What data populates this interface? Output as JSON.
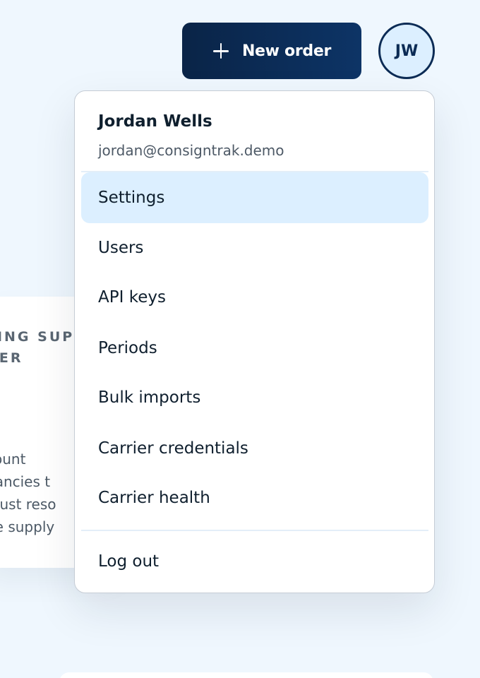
{
  "header": {
    "new_order_label": "New order",
    "avatar_initials": "JW"
  },
  "background_card": {
    "kicker_line1": "TING SUP",
    "kicker_line2": "NER",
    "body_lines": [
      "count",
      "pancies t",
      "must reso",
      "he supply"
    ]
  },
  "user_menu": {
    "name": "Jordan Wells",
    "email": "jordan@consigntrak.demo",
    "items": [
      {
        "label": "Settings",
        "active": true
      },
      {
        "label": "Users"
      },
      {
        "label": "API keys"
      },
      {
        "label": "Periods"
      },
      {
        "label": "Bulk imports"
      },
      {
        "label": "Carrier credentials"
      },
      {
        "label": "Carrier health"
      }
    ],
    "logout_label": "Log out"
  },
  "colors": {
    "page_bg": "#eff7fe",
    "primary_navy": "#0a2447",
    "active_item_bg": "#dcefff"
  }
}
